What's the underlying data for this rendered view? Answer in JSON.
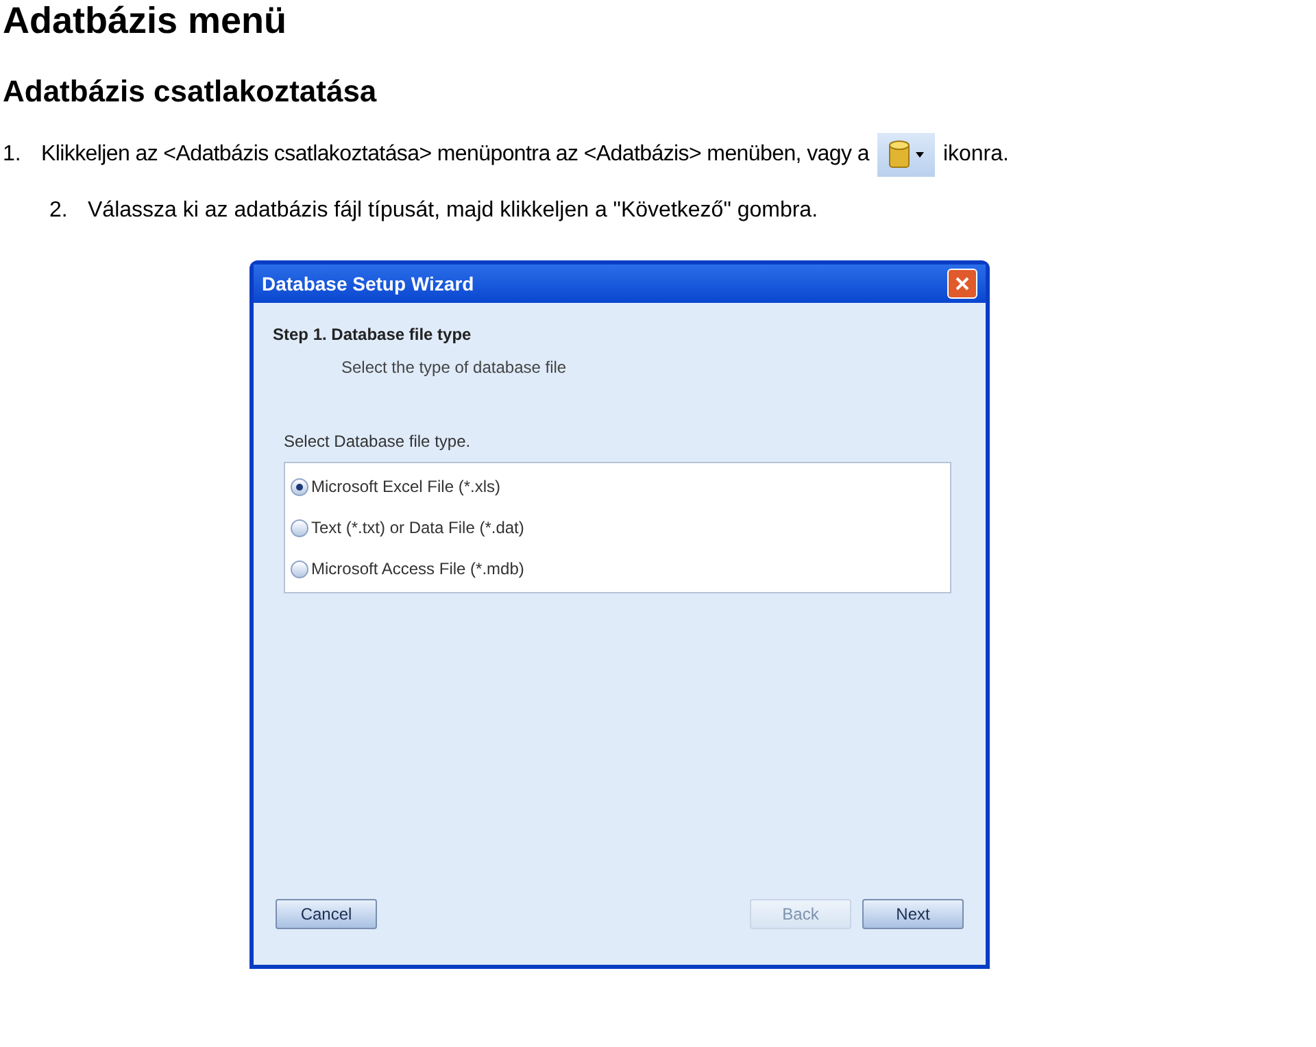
{
  "title": "Adatbázis menü",
  "subtitle": "Adatbázis csatlakoztatása",
  "steps": [
    {
      "number": "1.",
      "text": "Klikkeljen az <Adatbázis csatlakoztatása> menüpontra az <Adatbázis> menüben, vagy a",
      "after_icon": "ikonra.",
      "kind": "icon"
    },
    {
      "number": "2.",
      "text": "Válassza ki az adatbázis fájl típusát, majd klikkeljen a \"Következő\" gombra.",
      "kind": "plain"
    }
  ],
  "dialog": {
    "title": "Database Setup Wizard",
    "step_title": "Step 1. Database file type",
    "step_subtitle": "Select the type of database file",
    "group_label": "Select Database file type.",
    "options": [
      {
        "label": "Microsoft Excel File (*.xls)",
        "selected": true
      },
      {
        "label": "Text (*.txt) or Data File (*.dat)",
        "selected": false
      },
      {
        "label": "Microsoft Access File (*.mdb)",
        "selected": false
      }
    ],
    "buttons": [
      {
        "label": "Cancel",
        "disabled": false,
        "kind": "left"
      },
      {
        "label": "Back",
        "disabled": true,
        "kind": "right"
      },
      {
        "label": "Next",
        "disabled": false,
        "kind": "right"
      }
    ]
  }
}
